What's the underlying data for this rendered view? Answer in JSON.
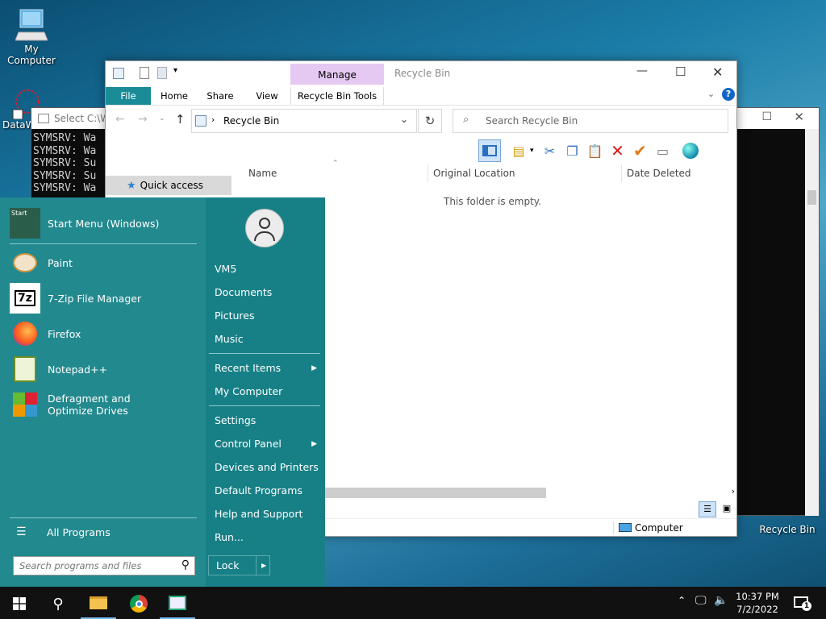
{
  "desktop": {
    "my_computer": "My Computer",
    "datawin": "DataW",
    "recycle_bin": "Recycle Bin"
  },
  "console": {
    "title": "Select C:\\W",
    "lines": [
      "SYMSRV:  Wa",
      "SYMSRV:  Wa",
      "SYMSRV:  Su",
      "SYMSRV:  Su",
      "SYMSRV:  Wa"
    ]
  },
  "explorer": {
    "title": "Recycle Bin",
    "manage_tab": "Manage",
    "tabs": {
      "file": "File",
      "home": "Home",
      "share": "Share",
      "view": "View",
      "tools": "Recycle Bin Tools"
    },
    "address": "Recycle Bin",
    "search_placeholder": "Search Recycle Bin",
    "quick_access": "Quick access",
    "columns": {
      "name": "Name",
      "original_location": "Original Location",
      "date_deleted": "Date Deleted"
    },
    "empty_message": "This folder is empty.",
    "status_location": "Computer"
  },
  "start_menu": {
    "programs": [
      {
        "label": "Start Menu (Windows)"
      },
      {
        "label": "Paint"
      },
      {
        "label": "7-Zip File Manager"
      },
      {
        "label": "Firefox"
      },
      {
        "label": "Notepad++"
      },
      {
        "label": "Defragment and Optimize Drives"
      }
    ],
    "all_programs": "All Programs",
    "search_placeholder": "Search programs and files",
    "user": "VM5",
    "right_items": {
      "documents": "Documents",
      "pictures": "Pictures",
      "music": "Music",
      "recent_items": "Recent Items",
      "my_computer": "My Computer",
      "settings": "Settings",
      "control_panel": "Control Panel",
      "devices_printers": "Devices and Printers",
      "default_programs": "Default Programs",
      "help_support": "Help and Support",
      "run": "Run..."
    },
    "lock": "Lock",
    "start_icon_text": "Start"
  },
  "taskbar": {
    "time": "10:37 PM",
    "date": "7/2/2022",
    "notification_count": "1"
  }
}
